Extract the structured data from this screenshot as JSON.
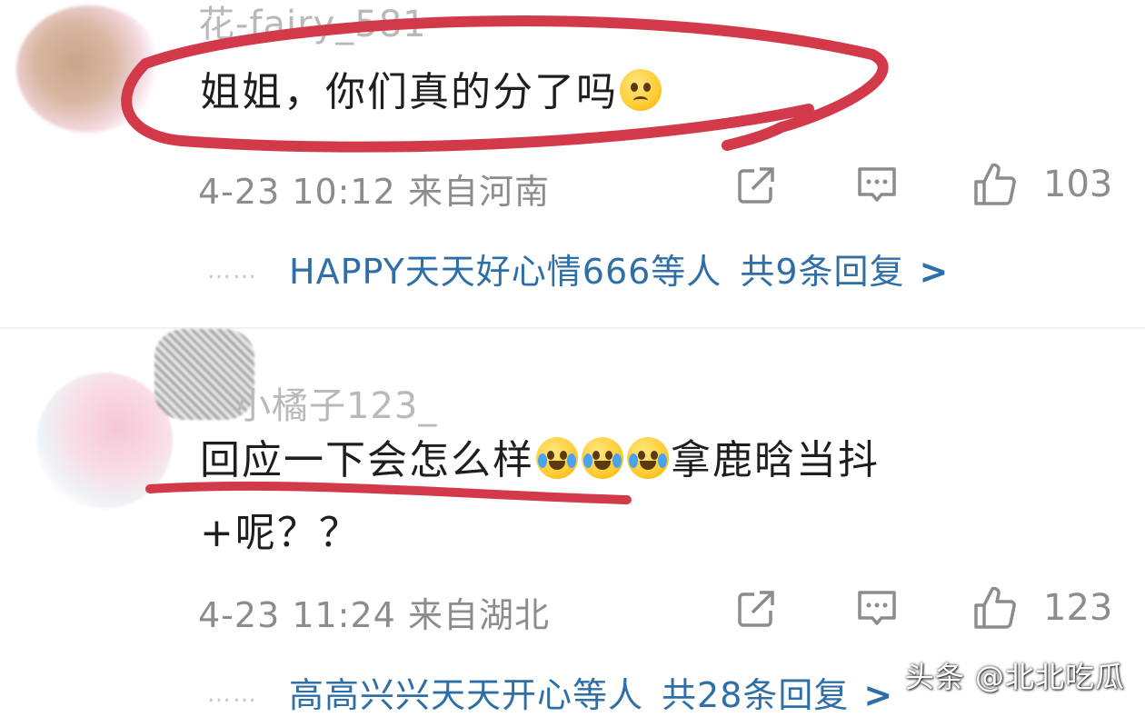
{
  "comments": [
    {
      "username": "花-fairy_581",
      "content": "姐姐，你们真的分了吗",
      "emoji": "pleading-face-icon",
      "time": "4-23 10:12",
      "location": "来自河南",
      "likes": "103",
      "reply_preview": {
        "dots": "……",
        "names": "HAPPY天天好心情666等人",
        "total": "共9条回复",
        "chevron": ">"
      }
    },
    {
      "username": "小橘子123_",
      "content_part1": "回应一下会怎么样",
      "emojis": [
        "laugh-cry-icon",
        "laugh-cry-icon",
        "laugh-cry-icon"
      ],
      "content_part2": "拿鹿晗当抖",
      "content_line2": "+呢？？",
      "time": "4-23 11:24",
      "location": "来自湖北",
      "likes": "123",
      "reply_preview": {
        "dots": "……",
        "names": "高高兴兴天天开心等人",
        "total": "共28条回复",
        "chevron": ">"
      }
    }
  ],
  "watermark": "头条 @北北吃瓜",
  "colors": {
    "link_blue": "#2f6fa8",
    "meta_gray": "#8c8c8c",
    "annotation_red": "#d23a4a"
  }
}
